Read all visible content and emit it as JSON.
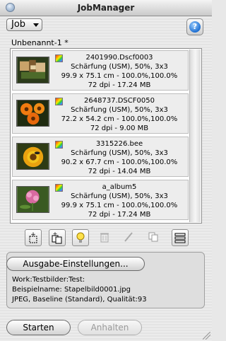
{
  "window": {
    "title": "JobManager"
  },
  "job_select": {
    "value": "Job"
  },
  "help_button": {
    "icon": "help-icon",
    "glyph": "?"
  },
  "document": {
    "name": "Unbenannt-1 *"
  },
  "items": [
    {
      "name": "2401990.Dscf0003",
      "settings": "Schärfung (USM), 50%, 3x3",
      "size": "99.9 x 75.1 cm - 100.0%,100.0%",
      "info": "72 dpi - 17.24 MB"
    },
    {
      "name": "2648737.DSCF0050",
      "settings": "Schärfung (USM), 50%, 3x3",
      "size": "72.2 x 54.2 cm - 100.0%,100.0%",
      "info": "72 dpi - 9.00 MB"
    },
    {
      "name": "3315226.bee",
      "settings": "Schärfung (USM), 50%, 3x3",
      "size": "90.2 x 67.7 cm - 100.0%,100.0%",
      "info": "72 dpi - 14.04 MB"
    },
    {
      "name": "a_album5",
      "settings": "Schärfung (USM), 50%, 3x3",
      "size": "99.9 x 75.1 cm - 100.0%,100.0%",
      "info": "72 dpi - 17.24 MB"
    }
  ],
  "toolbar": [
    {
      "name": "add-file-button",
      "icon": "add-file-icon"
    },
    {
      "name": "add-multiple-button",
      "icon": "add-multiple-icon"
    },
    {
      "name": "tip-button",
      "icon": "lightbulb-icon"
    },
    {
      "name": "delete-button",
      "icon": "trash-icon"
    },
    {
      "name": "edit-button",
      "icon": "pencil-icon"
    },
    {
      "name": "duplicate-button",
      "icon": "copy-icon"
    },
    {
      "name": "list-view-button",
      "icon": "list-view-icon"
    }
  ],
  "settings": {
    "button_label": "Ausgabe-Einstellungen...",
    "work_line": "Work:Testbilder:Test:",
    "example_line": "Beispielname: Stapelbild0001.jpg",
    "format_line": "JPEG, Baseline (Standard), Qualität:93"
  },
  "actions": {
    "start_label": "Starten",
    "stop_label": "Anhalten"
  }
}
